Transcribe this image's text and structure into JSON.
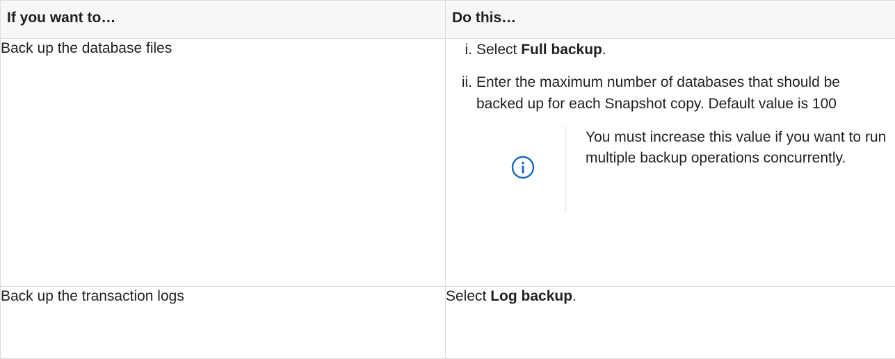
{
  "table": {
    "headers": [
      "If you want to…",
      "Do this…"
    ],
    "rows": [
      {
        "want": "Back up the database files",
        "steps": [
          {
            "marker": "i.",
            "prefix": "Select ",
            "bold": "Full backup",
            "suffix": "."
          },
          {
            "marker": "ii.",
            "text": "Enter the maximum number of databases that should be backed up for each Snapshot copy. Default value is 100"
          }
        ],
        "note": {
          "icon": "info-icon",
          "text": "You must increase this value if you want to run multiple backup operations concurrently."
        }
      },
      {
        "want": "Back up the transaction logs",
        "do": {
          "prefix": "Select ",
          "bold": "Log backup",
          "suffix": "."
        }
      }
    ]
  },
  "colors": {
    "info_icon": "#1565c0",
    "border": "#dcdcdc",
    "header_bg": "#f7f7f7"
  }
}
